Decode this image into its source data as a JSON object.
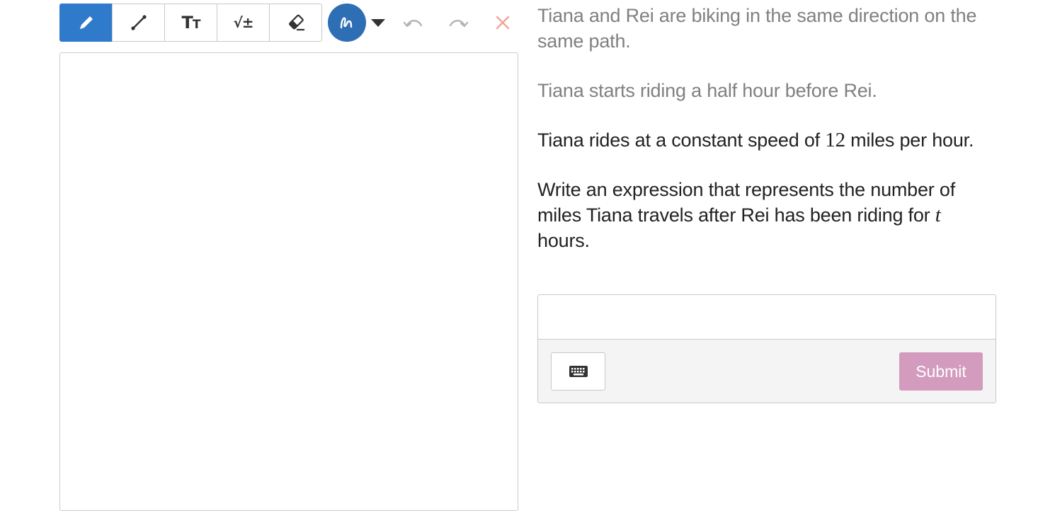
{
  "toolbar": {
    "tools": [
      {
        "name": "pen",
        "label": "",
        "active": true
      },
      {
        "name": "line",
        "label": ""
      },
      {
        "name": "text",
        "label_big": "T",
        "label_small": "T"
      },
      {
        "name": "math",
        "label": "√±"
      },
      {
        "name": "eraser",
        "label": ""
      }
    ],
    "icons": {
      "pen": "pencil-icon",
      "line": "line-tool-icon",
      "text": "text-size-icon",
      "math": "sqrt-plus-minus-icon",
      "eraser": "eraser-icon",
      "color": "squiggle-icon",
      "dropdown": "caret-down-icon",
      "undo": "undo-icon",
      "redo": "redo-icon",
      "clear": "close-icon"
    },
    "colors": {
      "active_tool": "#2f7acb",
      "current_color": "#2e6eb5",
      "undo_redo": "#b5b5b5",
      "clear": "#f0a59a"
    }
  },
  "question": {
    "p1": "Tiana and Rei are biking in the same direction on the same path.",
    "p2": "Tiana starts riding a half hour before Rei.",
    "p3_before": "Tiana rides at a constant speed of ",
    "p3_num": "12",
    "p3_after": " miles per hour.",
    "p4_before": "Write an expression that represents the number of miles Tiana travels after Rei has been riding for ",
    "p4_var": "t",
    "p4_after": " hours."
  },
  "answer": {
    "input_value": "",
    "keyboard_icon": "keyboard-icon",
    "submit_label": "Submit",
    "submit_color": "#d39bbd"
  }
}
